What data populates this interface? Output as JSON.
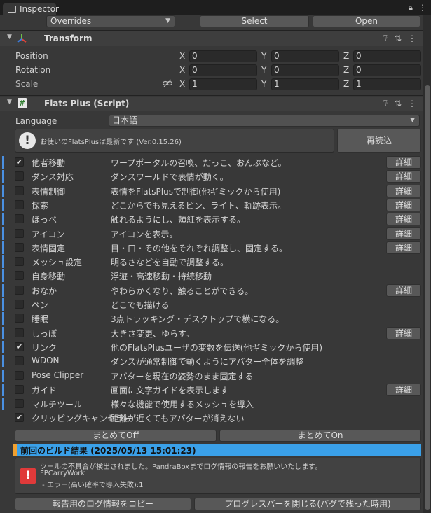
{
  "window": {
    "tab_title": "Inspector",
    "lock_icon": "lock-icon",
    "menu_icon": "kebab-menu-icon"
  },
  "prefab_bar": {
    "overrides": "Overrides",
    "select": "Select",
    "open": "Open"
  },
  "transform": {
    "title": "Transform",
    "position": {
      "label": "Position",
      "x": "0",
      "y": "0",
      "z": "0"
    },
    "rotation": {
      "label": "Rotation",
      "x": "0",
      "y": "0",
      "z": "0"
    },
    "scale": {
      "label": "Scale",
      "x": "1",
      "y": "1",
      "z": "1"
    },
    "axis": {
      "x": "X",
      "y": "Y",
      "z": "Z"
    }
  },
  "flats": {
    "title": "Flats Plus (Script)",
    "language_label": "Language",
    "language_value": "日本語",
    "info": "お使いのFlatsPlusは最新です (Ver.0.15.26)",
    "reload": "再読込",
    "detail_label": "詳細",
    "modules": [
      {
        "name": "他者移動",
        "desc": "ワープポータルの召喚、だっこ、おんぶなど。",
        "checked": true,
        "detail": true,
        "marker": true
      },
      {
        "name": "ダンス対応",
        "desc": "ダンスワールドで表情が動く。",
        "checked": false,
        "detail": true,
        "marker": true
      },
      {
        "name": "表情制御",
        "desc": "表情をFlatsPlusで制御(他ギミックから使用)",
        "checked": false,
        "detail": true,
        "marker": true
      },
      {
        "name": "探索",
        "desc": "どこからでも見えるピン、ライト、軌跡表示。",
        "checked": false,
        "detail": true,
        "marker": true
      },
      {
        "name": "ほっぺ",
        "desc": "触れるようにし、頬紅を表示する。",
        "checked": false,
        "detail": true,
        "marker": true
      },
      {
        "name": "アイコン",
        "desc": "アイコンを表示。",
        "checked": false,
        "detail": true,
        "marker": true
      },
      {
        "name": "表情固定",
        "desc": "目・口・その他をそれぞれ調整し、固定する。",
        "checked": false,
        "detail": true,
        "marker": true
      },
      {
        "name": "メッシュ設定",
        "desc": "明るさなどを自動で調整する。",
        "checked": false,
        "detail": false,
        "marker": true
      },
      {
        "name": "自身移動",
        "desc": "浮遊・高速移動・持続移動",
        "checked": false,
        "detail": false,
        "marker": true
      },
      {
        "name": "おなか",
        "desc": "やわらかくなり、触ることができる。",
        "checked": false,
        "detail": true,
        "marker": true
      },
      {
        "name": "ペン",
        "desc": "どこでも描ける",
        "checked": false,
        "detail": false,
        "marker": true
      },
      {
        "name": "睡眠",
        "desc": "3点トラッキング・デスクトップで横になる。",
        "checked": false,
        "detail": false,
        "marker": true
      },
      {
        "name": "しっぽ",
        "desc": "大きさ変更、ゆらす。",
        "checked": false,
        "detail": true,
        "marker": true
      },
      {
        "name": "リンク",
        "desc": "他のFlatsPlusユーザの変数を伝送(他ギミックから使用)",
        "checked": true,
        "detail": false,
        "marker": true
      },
      {
        "name": "WDON",
        "desc": "ダンスが通常制御で動くようにアバター全体を調整",
        "checked": false,
        "detail": false,
        "marker": true
      },
      {
        "name": "Pose Clipper",
        "desc": "アバターを現在の姿勢のまま固定する",
        "checked": false,
        "detail": false,
        "marker": true
      },
      {
        "name": "ガイド",
        "desc": "画面に文字ガイドを表示します",
        "checked": false,
        "detail": true,
        "marker": true
      },
      {
        "name": "マルチツール",
        "desc": "様々な機能で使用するメッシュを導入",
        "checked": false,
        "detail": false,
        "marker": true
      },
      {
        "name": "クリッピングキャンセラー",
        "desc": "距離が近くてもアバターが消えない",
        "checked": true,
        "detail": false,
        "marker": false
      }
    ],
    "all_off": "まとめてOff",
    "all_on": "まとめてOn",
    "build_header": "前回のビルド結果 (2025/05/13 15:01:23)",
    "error_line1": "ツールの不具合が検出されました。PandraBoxまでログ情報の報告をお願いいたします。",
    "error_line2": "FPCarryWork",
    "error_line3": " - エラー(高い確率で導入失敗):1",
    "copy_log": "報告用のログ情報をコピー",
    "close_progress": "プログレスバーを閉じる(バグで残った時用)"
  },
  "colors": {
    "accent": "#3aa0e8",
    "marker": "#4a90e2",
    "error": "#e03a3a",
    "bg": "#383838"
  }
}
